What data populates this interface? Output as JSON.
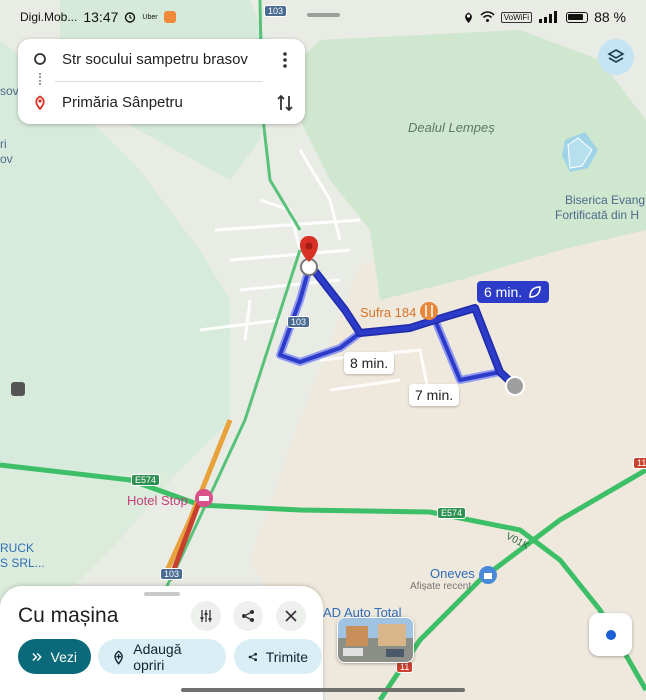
{
  "status_bar": {
    "carrier": "Digi.Mob...",
    "time": "13:47",
    "uber_label": "Uber",
    "volte_label": "VoWiFi",
    "battery": "88 %"
  },
  "route": {
    "origin": "Str socului sampetru brasov",
    "destination": "Primăria Sânpetru"
  },
  "map": {
    "labels": {
      "dealul_lempes": "Dealul Lempeș",
      "biserica_1": "Biserica Evang",
      "biserica_2": "Fortificată din H",
      "sufra": "Sufra 184",
      "hotel_stop": "Hotel Stop",
      "oneves": "Oneves",
      "oneves_sub": "Afișate recent",
      "ad_auto": "AD Auto Total",
      "ruck_1": "RUCK",
      "ruck_2": "S SRL...",
      "left_a": "sov",
      "left_b": "ri",
      "left_c": "ov"
    },
    "road_shields": {
      "r103_top": "103",
      "r103_mid": "103",
      "r103_bottom": "103",
      "e574_left": "E574",
      "e574_right": "E574",
      "e11_right": "11",
      "e11_bottom": "11",
      "v01k": "V01K"
    },
    "route_times": {
      "primary": "6 min.",
      "alt1": "8 min.",
      "alt2": "7 min."
    },
    "colors": {
      "route_primary": "#2d3bc9",
      "route_alt": "#8f98f0",
      "forest": "#cfe6cf",
      "land": "#e9ece4",
      "field": "#ede6d9",
      "highway": "#3dbf67",
      "destination_pin": "#d93025"
    }
  },
  "sheet": {
    "title": "Cu mașina",
    "buttons": {
      "view": "Vezi",
      "add_stops": "Adaugă opriri",
      "send": "Trimite"
    }
  }
}
